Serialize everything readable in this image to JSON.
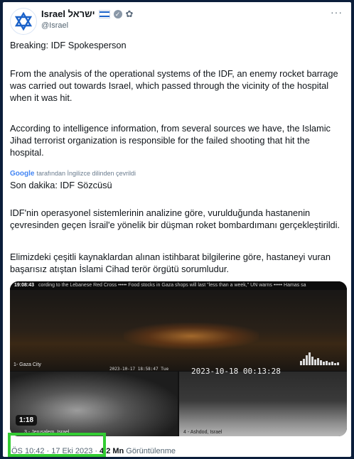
{
  "account": {
    "name": "Israel ישראל",
    "handle": "@Israel"
  },
  "tweet": {
    "line1": "Breaking: IDF Spokesperson",
    "para2": "From the analysis of the operational systems of the IDF, an enemy rocket barrage was carried out towards Israel, which passed through the vicinity of the hospital when it was hit.",
    "para3": "According to intelligence information, from several sources we have, the Islamic Jihad terrorist organization is responsible for the failed shooting that hit the hospital.",
    "translate_brand": "Google",
    "translate_text": "tarafından İngilizce dilinden çevrildi",
    "tr1": "Son dakika: IDF Sözcüsü",
    "tr2": "IDF'nin operasyonel sistemlerinin analizine göre, vurulduğunda hastanenin çevresinden geçen İsrail'e yönelik bir düşman roket bombardımanı gerçekleştirildi.",
    "tr3": "Elimizdeki çeşitli kaynaklardan alınan istihbarat bilgilerine göre, hastaneyi vuran başarısız atıştan İslami Cihad terör örgütü sorumludur."
  },
  "video": {
    "ticker_time": "19:08:43",
    "ticker_text": "cording to the Lebanese Red Cross  •••••  Food stocks in Gaza shops will last \"less than a week,\" UN warns  •••••  Hamas sa",
    "label_gaza": "1- Gaza City",
    "label_jerusalem": "3 - Jerusalem, Israel",
    "label_ashdod": "4 - Ashdod, Israel",
    "small_timestamp": "2023-10-17 18:58:47 Tue",
    "timestamp": "2023-10-18 00:13:28",
    "duration": "1:18"
  },
  "meta": {
    "time": "ÖS 10:42 · 17 Eki 2023",
    "separator": "·",
    "views_count": "4,2 Mn",
    "views_label": "Görüntülenme"
  },
  "colors": {
    "highlight": "#33cc33",
    "flag_blue": "#1b62c9"
  }
}
